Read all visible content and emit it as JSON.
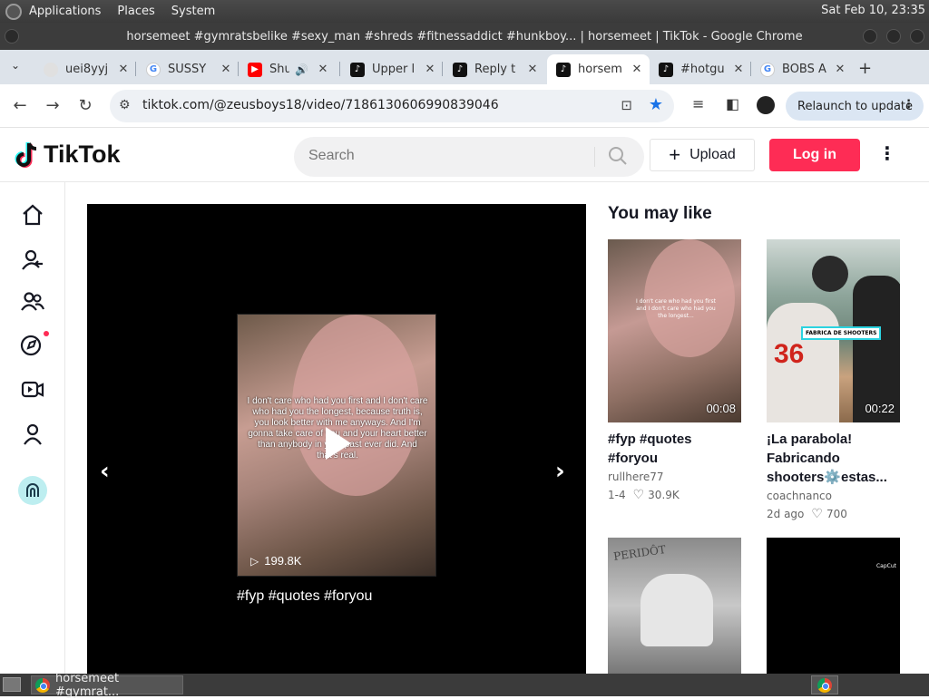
{
  "system_panel": {
    "menus": [
      "Applications",
      "Places",
      "System"
    ],
    "clock": "Sat Feb 10, 23:35"
  },
  "window": {
    "title": "horsemeet #gymratsbelike #sexy_man #shreds #fitnessaddict #hunkboy... | horsemeet | TikTok - Google Chrome"
  },
  "tabs": [
    {
      "title": "uei8yyj",
      "icon": "globe-icon"
    },
    {
      "title": "SUSSY",
      "icon": "google-icon"
    },
    {
      "title": "Shu",
      "icon": "youtube-icon",
      "audio": "speaker-icon"
    },
    {
      "title": "Upper l",
      "icon": "tiktok-icon"
    },
    {
      "title": "Reply t",
      "icon": "tiktok-icon"
    },
    {
      "title": "horsem",
      "icon": "tiktok-icon",
      "active": true
    },
    {
      "title": "#hotgu",
      "icon": "tiktok-icon"
    },
    {
      "title": "BOBS A",
      "icon": "google-icon"
    }
  ],
  "toolbar": {
    "url": "tiktok.com/@zeusboys18/video/7186130606990839046",
    "relaunch_label": "Relaunch to update"
  },
  "tiktok": {
    "logo_text": "TikTok",
    "search_placeholder": "Search",
    "upload_label": "Upload",
    "login_label": "Log in",
    "video": {
      "overlay_text": "I don't care who had you first and I don't care who had you the longest, because truth is, you look better with me anyways. And I'm gonna take care of you and your heart better than anybody in your past ever did. And that's real.",
      "views": "199.8K",
      "caption": "#fyp #quotes #foryou"
    },
    "recommendations_title": "You may like",
    "recommendations": [
      {
        "duration": "00:08",
        "title": "#fyp #quotes #foryou",
        "author": "rullhere77",
        "date": "1-4",
        "likes": "30.9K"
      },
      {
        "duration": "00:22",
        "title": "¡La parabola! Fabricando shooters⚙️estas...",
        "author": "coachnanco",
        "date": "2d ago",
        "likes": "700",
        "thumb_label": "FABRICA DE SHOOTERS",
        "jersey": "36"
      },
      {
        "brand": "PERIDÔT"
      },
      {
        "watermark": "CapCut"
      }
    ]
  },
  "taskbar": {
    "task_label": "horsemeet #gymrat..."
  },
  "colors": {
    "tiktok_red": "#fe2c55",
    "chrome_blue": "#1a73e8"
  }
}
